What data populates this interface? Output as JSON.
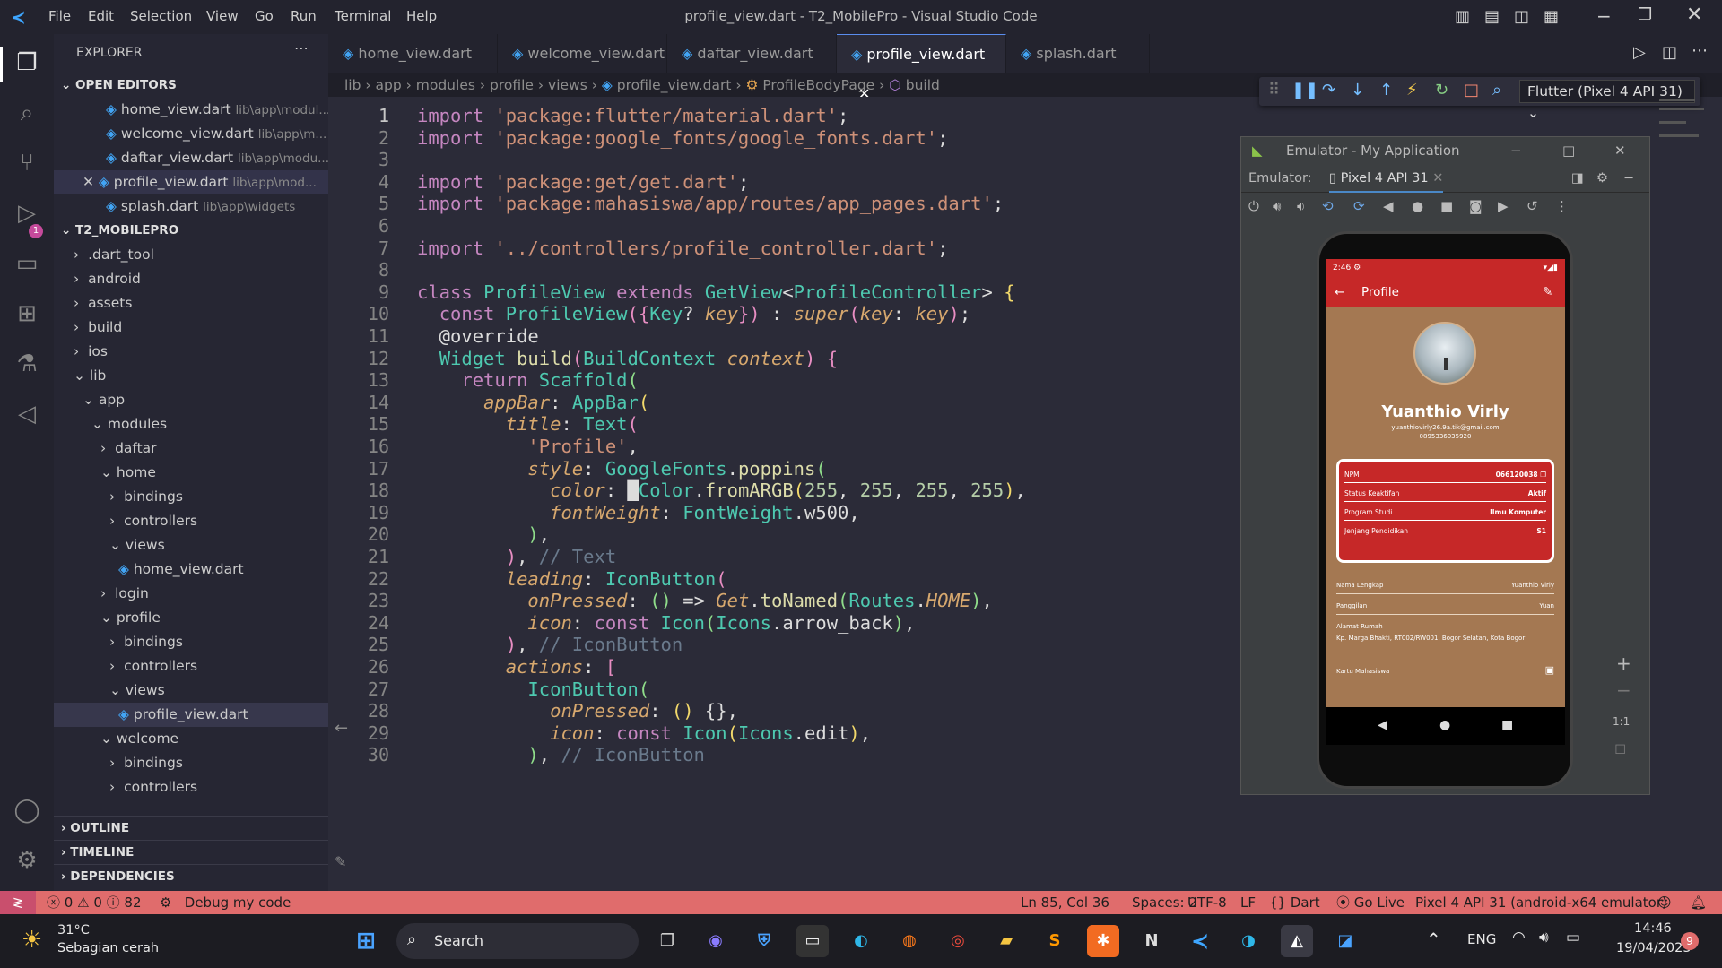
{
  "window": {
    "title": "profile_view.dart - T2_MobilePro - Visual Studio Code",
    "menu": [
      "File",
      "Edit",
      "Selection",
      "View",
      "Go",
      "Run",
      "Terminal",
      "Help"
    ]
  },
  "explorer": {
    "header": "EXPLORER",
    "open_editors_label": "OPEN EDITORS",
    "open_editors": [
      {
        "name": "home_view.dart",
        "path": "lib\\app\\modul..."
      },
      {
        "name": "welcome_view.dart",
        "path": "lib\\app\\m..."
      },
      {
        "name": "daftar_view.dart",
        "path": "lib\\app\\modu..."
      },
      {
        "name": "profile_view.dart",
        "path": "lib\\app\\mod..."
      },
      {
        "name": "splash.dart",
        "path": "lib\\app\\widgets"
      }
    ],
    "project_label": "T2_MOBILEPRO",
    "tree": [
      ".dart_tool",
      "android",
      "assets",
      "build",
      "ios",
      "lib",
      "app",
      "modules",
      "daftar",
      "home",
      "bindings",
      "controllers",
      "views",
      "home_view.dart",
      "login",
      "profile",
      "bindings",
      "controllers",
      "views",
      "profile_view.dart",
      "welcome",
      "bindings",
      "controllers"
    ],
    "outline_label": "OUTLINE",
    "timeline_label": "TIMELINE",
    "dependencies_label": "DEPENDENCIES"
  },
  "tabs": [
    "home_view.dart",
    "welcome_view.dart",
    "daftar_view.dart",
    "profile_view.dart",
    "splash.dart"
  ],
  "breadcrumb": [
    "lib",
    "app",
    "modules",
    "profile",
    "views",
    "profile_view.dart",
    "ProfileBodyPage",
    "build"
  ],
  "debug_target": "Flutter (Pixel 4 API 31)",
  "emulator": {
    "window_title": "Emulator - My Application",
    "label": "Emulator:",
    "device_tab": "Pixel 4 API 31",
    "zoom_label": "1:1",
    "phone": {
      "time": "2:46",
      "appbar_title": "Profile",
      "name": "Yuanthio Virly",
      "email": "yuanthiovirly26.9a.tik@gmail.com",
      "phone_number": "0895336035920",
      "card": [
        {
          "label": "NPM",
          "value": "066120038"
        },
        {
          "label": "Status Keaktifan",
          "value": "Aktif"
        },
        {
          "label": "Program Studi",
          "value": "Ilmu Komputer"
        },
        {
          "label": "Jenjang Pendidikan",
          "value": "S1"
        }
      ],
      "details": [
        {
          "label": "Nama Lengkap",
          "value": "Yuanthio Virly"
        },
        {
          "label": "Panggilan",
          "value": "Yuan"
        }
      ],
      "address_label": "Alamat Rumah",
      "address_value": "Kp. Marga Bhakti, RT002/RW001, Bogor Selatan, Kota Bogor",
      "ktm_label": "Kartu Mahasiswa"
    }
  },
  "status": {
    "errors": "0",
    "warnings": "0",
    "info": "82",
    "debug": "Debug my code",
    "position": "Ln 85, Col 36",
    "spaces": "Spaces: 2",
    "encoding": "UTF-8",
    "eol": "LF",
    "language": "Dart",
    "golive": "Go Live",
    "device": "Pixel 4 API 31 (android-x64 emulator)"
  },
  "taskbar": {
    "weather_temp": "31°C",
    "weather_desc": "Sebagian cerah",
    "search_label": "Search",
    "lang": "ENG",
    "time": "14:46",
    "date": "19/04/2023",
    "notif_count": "9"
  },
  "colors": {
    "accent": "#e06c6c",
    "phone_bg": "#a47852",
    "appbar": "#c62828"
  }
}
